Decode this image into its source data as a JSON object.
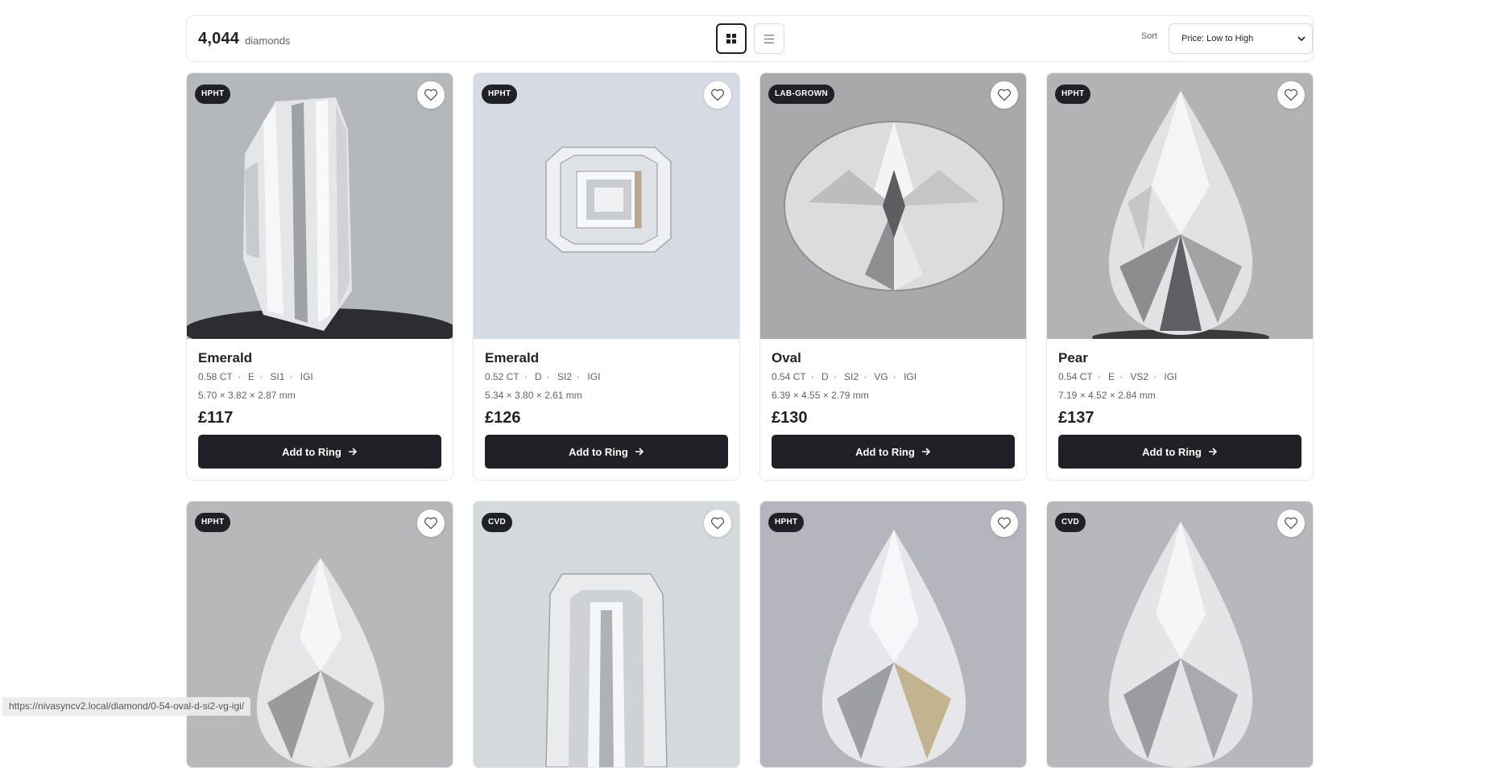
{
  "results": {
    "count": "4,044",
    "label": "diamonds"
  },
  "view": {
    "grid_icon": "grid-icon",
    "list_icon": "list-icon"
  },
  "sort": {
    "label": "Sort",
    "selected": "Price: Low to High",
    "icon": "chevron-down-icon"
  },
  "cards": [
    {
      "badge": "HPHT",
      "shape": "Emerald",
      "carat": "0.58 CT",
      "color": "E",
      "clarity": "SI1",
      "cut": "",
      "lab": "IGI",
      "dims": "5.70 × 3.82 × 2.87 mm",
      "price": "£117",
      "cta": "Add to Ring",
      "bg": "#b5b8bb"
    },
    {
      "badge": "HPHT",
      "shape": "Emerald",
      "carat": "0.52 CT",
      "color": "D",
      "clarity": "SI2",
      "cut": "",
      "lab": "IGI",
      "dims": "5.34 × 3.80 × 2.61 mm",
      "price": "£126",
      "cta": "Add to Ring",
      "bg": "#d6dae3"
    },
    {
      "badge": "LAB-GROWN",
      "shape": "Oval",
      "carat": "0.54 CT",
      "color": "D",
      "clarity": "SI2",
      "cut": "VG",
      "lab": "IGI",
      "dims": "6.39 × 4.55 × 2.79 mm",
      "price": "£130",
      "cta": "Add to Ring",
      "bg": "#a9a9ab"
    },
    {
      "badge": "HPHT",
      "shape": "Pear",
      "carat": "0.54 CT",
      "color": "E",
      "clarity": "VS2",
      "cut": "",
      "lab": "IGI",
      "dims": "7.19 × 4.52 × 2.84 mm",
      "price": "£137",
      "cta": "Add to Ring",
      "bg": "#b3b3b5"
    },
    {
      "badge": "HPHT",
      "bg": "#b8b8ba"
    },
    {
      "badge": "CVD",
      "bg": "#d4d9dc"
    },
    {
      "badge": "HPHT",
      "bg": "#b5b5bd"
    },
    {
      "badge": "CVD",
      "bg": "#b8b8bc"
    }
  ],
  "status_url": "https://nivasyncv2.local/diamond/0-54-oval-d-si2-vg-igi/"
}
